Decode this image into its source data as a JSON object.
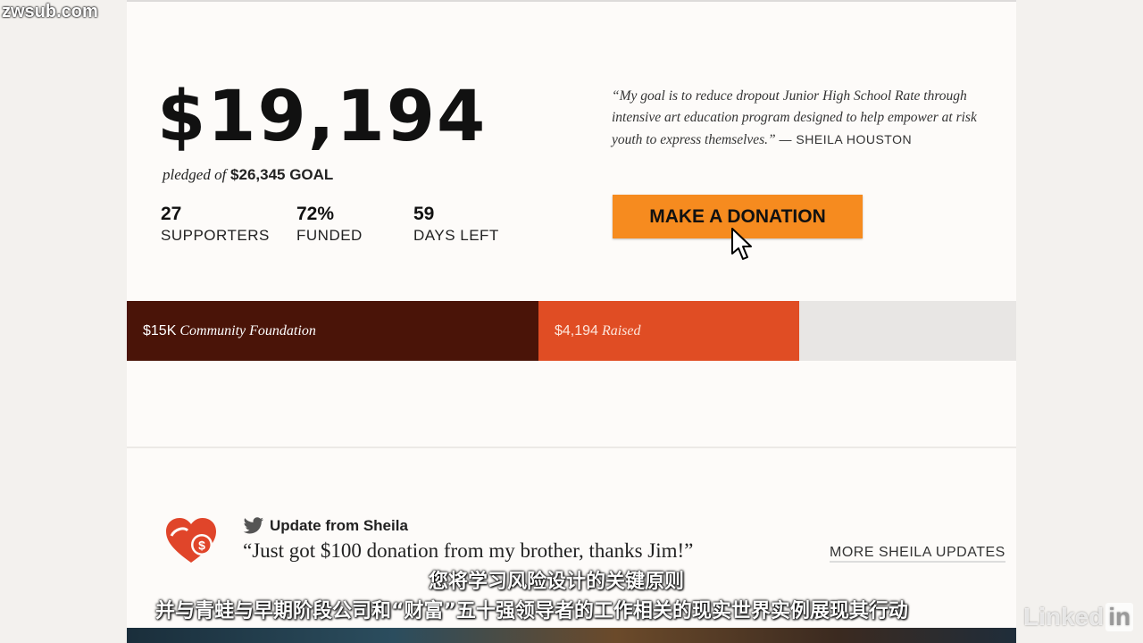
{
  "watermark": "zwsub.com",
  "pledge": {
    "amount": "$19,194",
    "pledged_prefix": "pledged of",
    "goal": "$26,345 GOAL"
  },
  "stats": [
    {
      "value": "27",
      "label": "SUPPORTERS"
    },
    {
      "value": "72%",
      "label": "FUNDED"
    },
    {
      "value": "59",
      "label": "DAYS LEFT"
    }
  ],
  "quote": {
    "text": "“My goal is to reduce dropout Junior High School Rate through intensive art education program designed to help empower at risk youth to express themselves.”",
    "author": "— SHEILA HOUSTON"
  },
  "donate_button": "MAKE A DONATION",
  "progress": {
    "segment1_amount": "$15K",
    "segment1_label": "Community Foundation",
    "segment2_amount": "$4,194",
    "segment2_label": "Raised",
    "foundation_fraction": 0.463,
    "raised_fraction": 0.293,
    "colors": {
      "foundation": "#4a1408",
      "raised": "#e04d24",
      "remaining": "#e8e6e4"
    }
  },
  "update": {
    "title": "Update from Sheila",
    "quote": "“Just got $100 donation from my brother, thanks Jim!”",
    "more_link": "MORE SHEILA UPDATES"
  },
  "subtitles": {
    "line1": "您将学习风险设计的关键原则",
    "line2": "并与青蛙与早期阶段公司和“财富”五十强领导者的工作相关的现实世界实例展现其行动"
  },
  "logo": {
    "text": "Linked",
    "in": "in"
  },
  "colors": {
    "accent": "#f68b1f",
    "heart": "#e0452a"
  }
}
